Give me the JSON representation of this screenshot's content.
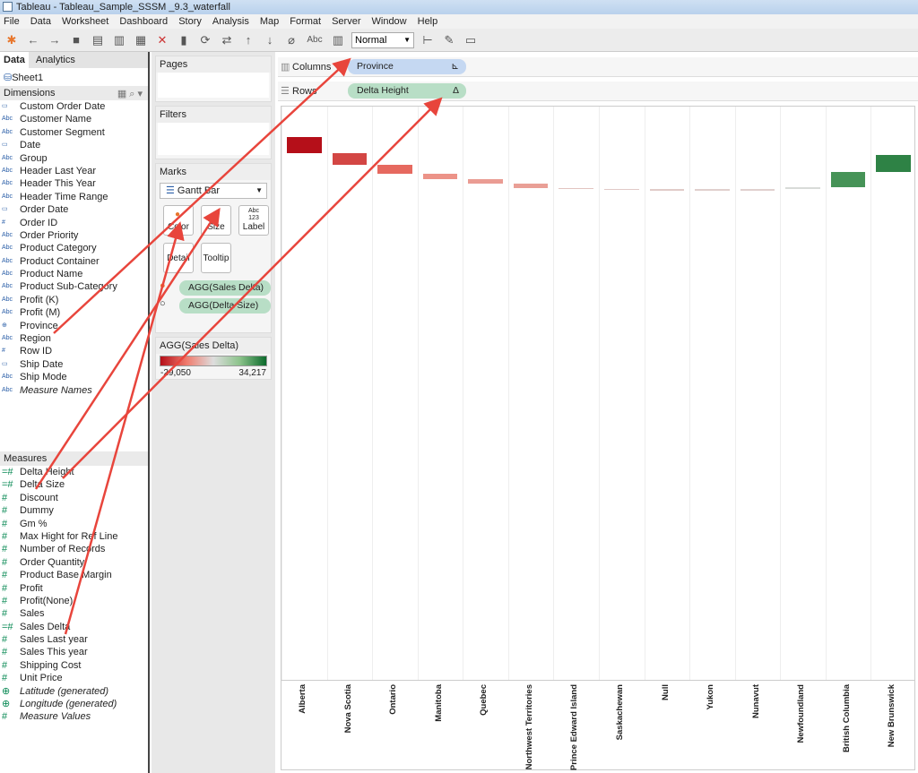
{
  "window": {
    "title": "Tableau - Tableau_Sample_SSSM _9.3_waterfall"
  },
  "menu": [
    "File",
    "Data",
    "Worksheet",
    "Dashboard",
    "Story",
    "Analysis",
    "Map",
    "Format",
    "Server",
    "Window",
    "Help"
  ],
  "toolbar": {
    "fit_select": "Normal",
    "abc": "Abc"
  },
  "left": {
    "tab_data": "Data",
    "tab_analytics": "Analytics",
    "datasource": "Sheet1",
    "dimensions_label": "Dimensions",
    "measures_label": "Measures",
    "dimensions": [
      {
        "icon": "date-icon",
        "name": "Custom Order Date"
      },
      {
        "icon": "abc-icon",
        "name": "Customer Name"
      },
      {
        "icon": "abc-icon",
        "name": "Customer Segment"
      },
      {
        "icon": "date-icon",
        "name": "Date"
      },
      {
        "icon": "abc-icon",
        "name": "Group"
      },
      {
        "icon": "abc-icon",
        "name": "Header Last Year"
      },
      {
        "icon": "abc-icon",
        "name": "Header This Year"
      },
      {
        "icon": "abc-icon",
        "name": "Header Time Range"
      },
      {
        "icon": "date-icon",
        "name": "Order Date"
      },
      {
        "icon": "number-icon",
        "name": "Order ID"
      },
      {
        "icon": "abc-icon",
        "name": "Order Priority"
      },
      {
        "icon": "abc-icon",
        "name": "Product Category"
      },
      {
        "icon": "abc-icon",
        "name": "Product Container"
      },
      {
        "icon": "abc-icon",
        "name": "Product Name"
      },
      {
        "icon": "abc-icon",
        "name": "Product Sub-Category"
      },
      {
        "icon": "abc-icon",
        "name": "Profit (K)"
      },
      {
        "icon": "abc-icon",
        "name": "Profit (M)"
      },
      {
        "icon": "globe-icon",
        "name": "Province"
      },
      {
        "icon": "abc-icon",
        "name": "Region"
      },
      {
        "icon": "number-icon",
        "name": "Row ID"
      },
      {
        "icon": "date-icon",
        "name": "Ship Date"
      },
      {
        "icon": "abc-icon",
        "name": "Ship Mode"
      },
      {
        "icon": "abc-icon",
        "name": "Measure Names",
        "italic": true
      }
    ],
    "measures": [
      {
        "icon": "calc-number-icon",
        "name": "Delta Height"
      },
      {
        "icon": "calc-number-icon",
        "name": "Delta Size"
      },
      {
        "icon": "number-icon",
        "name": "Discount"
      },
      {
        "icon": "number-icon",
        "name": "Dummy"
      },
      {
        "icon": "number-icon",
        "name": "Gm %"
      },
      {
        "icon": "number-icon",
        "name": "Max Hight for Ref Line"
      },
      {
        "icon": "number-icon",
        "name": "Number of Records"
      },
      {
        "icon": "number-icon",
        "name": "Order Quantity"
      },
      {
        "icon": "number-icon",
        "name": "Product Base Margin"
      },
      {
        "icon": "number-icon",
        "name": "Profit"
      },
      {
        "icon": "number-icon",
        "name": "Profit(None)"
      },
      {
        "icon": "number-icon",
        "name": "Sales"
      },
      {
        "icon": "calc-number-icon",
        "name": "Sales Delta"
      },
      {
        "icon": "number-icon",
        "name": "Sales Last year"
      },
      {
        "icon": "number-icon",
        "name": "Sales This year"
      },
      {
        "icon": "number-icon",
        "name": "Shipping Cost"
      },
      {
        "icon": "number-icon",
        "name": "Unit Price"
      },
      {
        "icon": "globe-icon",
        "name": "Latitude (generated)",
        "italic": true
      },
      {
        "icon": "globe-icon",
        "name": "Longitude (generated)",
        "italic": true
      },
      {
        "icon": "number-icon",
        "name": "Measure Values",
        "italic": true
      }
    ]
  },
  "cards": {
    "pages": "Pages",
    "filters": "Filters",
    "marks": "Marks",
    "mark_type": "Gantt Bar",
    "color": "Color",
    "size": "Size",
    "label": "Label",
    "label_glyph": "Abc 123",
    "detail": "Detail",
    "tooltip": "Tooltip",
    "pills": [
      "AGG(Sales Delta)",
      "AGG(Delta Size)"
    ],
    "legend": {
      "title": "AGG(Sales Delta)",
      "min": "-29,050",
      "max": "34,217",
      "colors": [
        "#b50f19",
        "#f07c6e",
        "#dddddd",
        "#8cc38b",
        "#0c6a2c"
      ]
    }
  },
  "shelves": {
    "columns_label": "Columns",
    "columns_pill": "Province",
    "rows_label": "Rows",
    "rows_pill": "Delta Height",
    "rows_pill_glyph": "Δ"
  },
  "chart_data": {
    "type": "gantt-waterfall",
    "categories": [
      "Alberta",
      "Nova Scotia",
      "Ontario",
      "Manitoba",
      "Quebec",
      "Northwest Territories",
      "Prince Edward Island",
      "Saskachewan",
      "Null",
      "Yukon",
      "Nunavut",
      "Newfoundland",
      "British Columbia",
      "New Brunswick"
    ],
    "values": [
      -29050,
      -21000,
      -16000,
      -9500,
      -8000,
      -7500,
      -1500,
      -600,
      -400,
      300,
      400,
      3500,
      27000,
      30000
    ],
    "color_range": [
      -29050,
      34217
    ]
  }
}
